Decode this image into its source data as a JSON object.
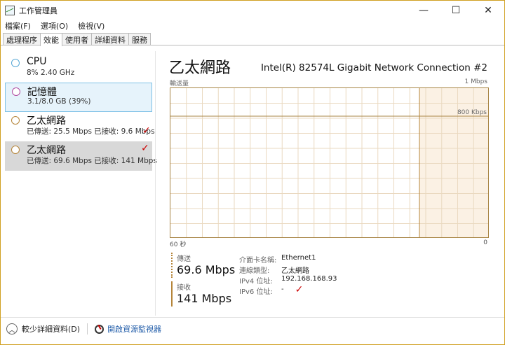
{
  "window": {
    "title": "工作管理員",
    "controls": [
      "—",
      "☐",
      "✕"
    ]
  },
  "menu": [
    "檔案(F)",
    "選項(O)",
    "檢視(V)"
  ],
  "tabs": [
    {
      "label": "處理程序",
      "active": false
    },
    {
      "label": "效能",
      "active": true
    },
    {
      "label": "使用者",
      "active": false
    },
    {
      "label": "詳細資料",
      "active": false
    },
    {
      "label": "服務",
      "active": false
    }
  ],
  "resources": [
    {
      "name": "CPU",
      "detail": "8% 2.40 GHz"
    },
    {
      "name": "記憶體",
      "detail": "3.1/8.0 GB (39%)"
    },
    {
      "name": "乙太網路",
      "detail": "已傳送: 25.5 Mbps 已接收: 9.6 Mbps"
    },
    {
      "name": "乙太網路",
      "detail": "已傳送: 69.6 Mbps 已接收: 141 Mbps"
    }
  ],
  "detail": {
    "title": "乙太網路",
    "adapter": "Intel(R) 82574L Gigabit Network Connection #2",
    "graph_label": "輸送量",
    "graph_max": "1 Mbps",
    "graph_scale": "800 Kbps",
    "axis_left": "60 秒",
    "axis_right": "0",
    "send_label": "傳送",
    "send_value": "69.6 Mbps",
    "recv_label": "接收",
    "recv_value": "141 Mbps",
    "props": [
      {
        "k": "介面卡名稱:",
        "v": "Ethernet1"
      },
      {
        "k": "連線類型:",
        "v": "乙太網路"
      },
      {
        "k": "IPv4 位址:",
        "v": "192.168.168.93"
      },
      {
        "k": "IPv6 位址:",
        "v": "-"
      }
    ]
  },
  "bottom": {
    "fewer_details": "較少詳細資料(D)",
    "open_monitor": "開啟資源監視器"
  },
  "colors": {
    "accent_graph": "#a88545",
    "highlight_fill": "#fbf1e4",
    "check_mark": "#cc0000",
    "link": "#1f5ba8"
  }
}
